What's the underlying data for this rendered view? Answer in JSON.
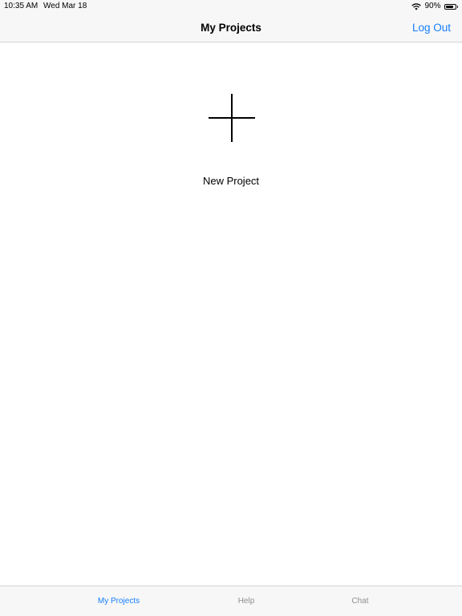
{
  "status_bar": {
    "time": "10:35 AM",
    "date": "Wed Mar 18",
    "battery": "90%",
    "battery_level": 0.9,
    "wifi_icon": "wifi-icon",
    "battery_icon": "battery-icon"
  },
  "nav": {
    "title": "My Projects",
    "right_button": "Log Out"
  },
  "main": {
    "new_project_icon": "plus-icon",
    "new_project_label": "New Project"
  },
  "tab_bar": {
    "tabs": [
      {
        "label": "My Projects",
        "active": true
      },
      {
        "label": "Help",
        "active": false
      },
      {
        "label": "Chat",
        "active": false
      }
    ]
  },
  "colors": {
    "accent": "#147efb",
    "inactive_tab": "#8e8e93",
    "bar_background": "#f7f7f7"
  }
}
